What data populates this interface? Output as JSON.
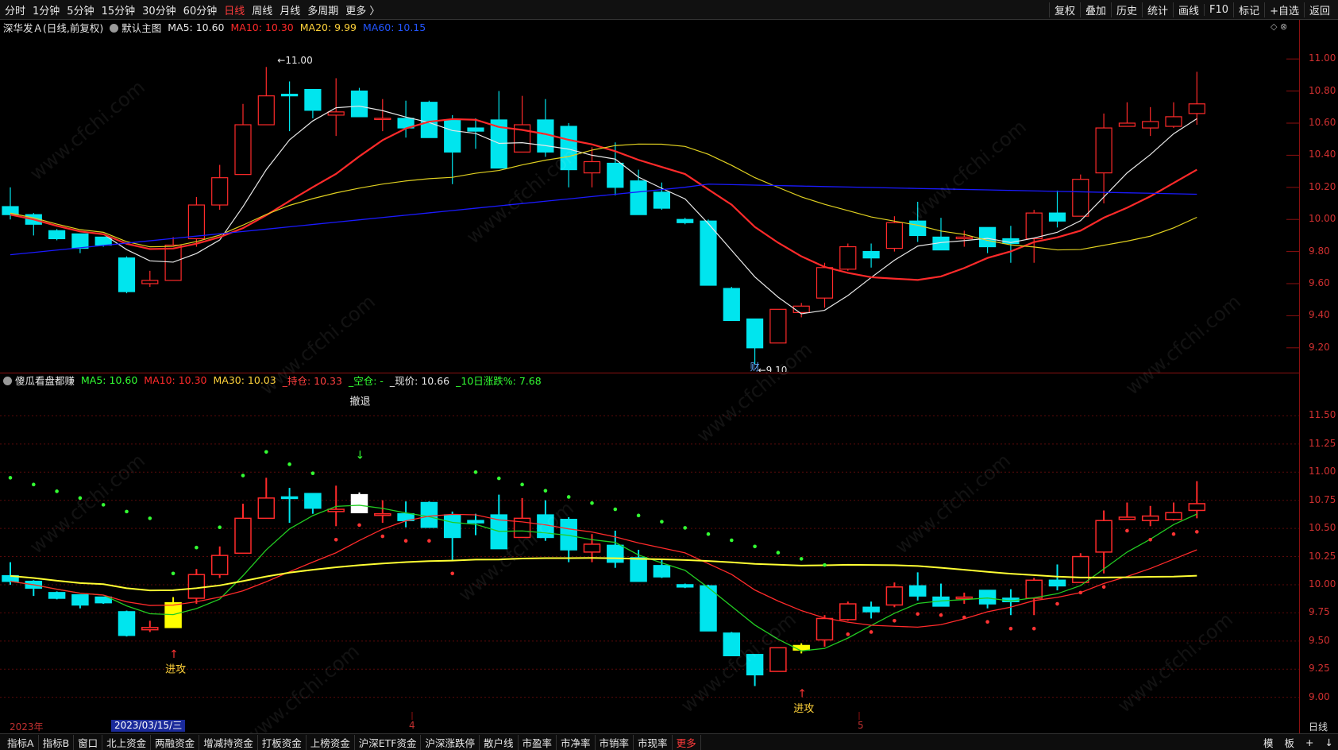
{
  "toolbar": {
    "periods": [
      "分时",
      "1分钟",
      "5分钟",
      "15分钟",
      "30分钟",
      "60分钟",
      "日线",
      "周线",
      "月线",
      "多周期",
      "更多 〉"
    ],
    "active_period": "日线",
    "tools": [
      "复权",
      "叠加",
      "历史",
      "统计",
      "画线",
      "F10",
      "标记",
      "+自选",
      "返回"
    ]
  },
  "main_panel": {
    "symbol": "深华发Ａ(日线,前复权)",
    "template": "默认主图",
    "ma5": "MA5: 10.60",
    "ma10": "MA10: 10.30",
    "ma20": "MA20: 9.99",
    "ma60": "MA60: 10.15",
    "high_marker": "11.00",
    "low_marker": "9.10",
    "event_marker": "财",
    "y_ticks": [
      "11.00",
      "10.80",
      "10.60",
      "10.40",
      "10.20",
      "10.00",
      "9.80",
      "9.60",
      "9.40",
      "9.20"
    ]
  },
  "sub_panel": {
    "indicator": "傻瓜看盘都赚",
    "ma5": "MA5: 10.60",
    "ma10": "MA10: 10.30",
    "ma30": "MA30: 10.03",
    "hold": "_持仓: 10.33",
    "empty": "_空仓: -",
    "price": "_现价: 10.66",
    "change10": "_10日涨跌%: 7.68",
    "retreat_label": "撤退",
    "attack_label_1": "进攻",
    "attack_label_2": "进攻",
    "y_ticks": [
      "11.50",
      "11.25",
      "11.00",
      "10.75",
      "10.50",
      "10.25",
      "10.00",
      "9.75",
      "9.50",
      "9.25",
      "9.00"
    ]
  },
  "x_axis": {
    "year_label": "2023年",
    "cursor_date": "2023/03/15/三",
    "month_4": "4",
    "month_5": "5",
    "axis_label": "日线"
  },
  "bottom_bar": {
    "items": [
      "指标A",
      "指标B",
      "窗口",
      "北上资金",
      "两融资金",
      "增减持资金",
      "打板资金",
      "上榜资金",
      "沪深ETF资金",
      "沪深涨跌停",
      "散户线",
      "市盈率",
      "市净率",
      "市销率",
      "市现率",
      "更多"
    ],
    "right": [
      "模",
      "板",
      "+",
      "↓"
    ]
  },
  "watermark": "www.cfchi.com",
  "colors": {
    "up": "#ff2a2a",
    "down": "#00e5ee",
    "ma5": "#e8e8e8",
    "ma10": "#ff2a2a",
    "ma20": "#e0d020",
    "ma60": "#1a1aff",
    "sub_ma5": "#22cc22",
    "sub_ma30": "#ffff33"
  },
  "chart_data": {
    "type": "candlestick",
    "main": {
      "ohlc": [
        [
          10.08,
          10.2,
          10.0,
          10.03
        ],
        [
          10.03,
          10.04,
          9.9,
          9.97
        ],
        [
          9.93,
          9.94,
          9.87,
          9.88
        ],
        [
          9.91,
          9.91,
          9.79,
          9.82
        ],
        [
          9.89,
          9.89,
          9.83,
          9.84
        ],
        [
          9.76,
          9.77,
          9.54,
          9.55
        ],
        [
          9.6,
          9.68,
          9.58,
          9.62
        ],
        [
          9.62,
          9.89,
          9.62,
          9.84
        ],
        [
          9.88,
          10.14,
          9.83,
          10.09
        ],
        [
          10.09,
          10.34,
          10.06,
          10.26
        ],
        [
          10.28,
          10.72,
          10.28,
          10.59
        ],
        [
          10.59,
          10.95,
          10.59,
          10.77
        ],
        [
          10.78,
          10.86,
          10.55,
          10.77
        ],
        [
          10.81,
          10.8,
          10.63,
          10.68
        ],
        [
          10.65,
          10.88,
          10.52,
          10.67
        ],
        [
          10.8,
          10.82,
          10.65,
          10.64
        ],
        [
          10.63,
          10.75,
          10.55,
          10.63
        ],
        [
          10.63,
          10.74,
          10.51,
          10.57
        ],
        [
          10.73,
          10.74,
          10.51,
          10.51
        ],
        [
          10.62,
          10.65,
          10.22,
          10.42
        ],
        [
          10.57,
          10.63,
          10.44,
          10.55
        ],
        [
          10.62,
          10.8,
          10.48,
          10.32
        ],
        [
          10.42,
          10.77,
          10.46,
          10.59
        ],
        [
          10.62,
          10.75,
          10.39,
          10.42
        ],
        [
          10.58,
          10.6,
          10.2,
          10.31
        ],
        [
          10.29,
          10.45,
          10.2,
          10.36
        ],
        [
          10.35,
          10.48,
          10.15,
          10.2
        ],
        [
          10.24,
          10.31,
          10.08,
          10.03
        ],
        [
          10.17,
          10.23,
          10.06,
          10.07
        ],
        [
          10.0,
          10.01,
          9.97,
          9.98
        ],
        [
          9.99,
          10.0,
          9.65,
          9.59
        ],
        [
          9.57,
          9.58,
          9.37,
          9.37
        ],
        [
          9.38,
          9.38,
          9.1,
          9.2
        ],
        [
          9.23,
          9.42,
          9.26,
          9.44
        ],
        [
          9.42,
          9.48,
          9.39,
          9.46
        ],
        [
          9.51,
          9.73,
          9.45,
          9.7
        ],
        [
          9.69,
          9.85,
          9.68,
          9.83
        ],
        [
          9.8,
          9.85,
          9.7,
          9.76
        ],
        [
          9.82,
          10.02,
          9.8,
          9.98
        ],
        [
          9.99,
          10.11,
          9.86,
          9.9
        ],
        [
          9.89,
          10.01,
          9.85,
          9.81
        ],
        [
          9.88,
          9.93,
          9.83,
          9.89
        ],
        [
          9.95,
          9.95,
          9.79,
          9.83
        ],
        [
          9.88,
          9.96,
          9.73,
          9.85
        ],
        [
          9.88,
          10.06,
          9.73,
          10.04
        ],
        [
          10.04,
          10.18,
          9.95,
          9.99
        ],
        [
          10.02,
          10.28,
          10.05,
          10.25
        ],
        [
          10.29,
          10.66,
          10.1,
          10.57
        ],
        [
          10.58,
          10.73,
          10.6,
          10.6
        ],
        [
          10.57,
          10.7,
          10.52,
          10.61
        ],
        [
          10.58,
          10.73,
          10.57,
          10.64
        ],
        [
          10.66,
          10.92,
          10.59,
          10.72
        ]
      ],
      "ylim": [
        9.1,
        11.1
      ]
    }
  }
}
